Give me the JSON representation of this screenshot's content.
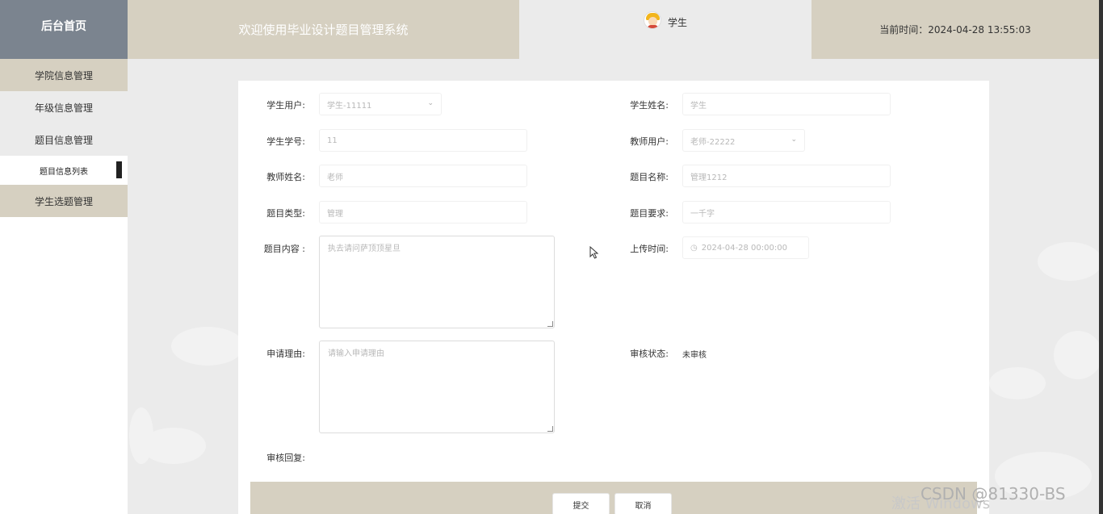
{
  "header": {
    "brand": "后台首页",
    "welcome": "欢迎使用毕业设计题目管理系统",
    "user_name": "学生",
    "current_time": "当前时间：2024-04-28 13:55:03"
  },
  "sidebar": {
    "items": [
      {
        "label": "学院信息管理"
      },
      {
        "label": "年级信息管理"
      },
      {
        "label": "题目信息管理"
      },
      {
        "label": "题目信息列表"
      },
      {
        "label": "学生选题管理"
      }
    ]
  },
  "form": {
    "student_user": {
      "label": "学生用户:",
      "value": "学生-11111"
    },
    "student_name": {
      "label": "学生姓名:",
      "value": "学生"
    },
    "student_no": {
      "label": "学生学号:",
      "value": "11"
    },
    "teacher_user": {
      "label": "教师用户:",
      "value": "老师-22222"
    },
    "teacher_name": {
      "label": "教师姓名:",
      "value": "老师"
    },
    "topic_name": {
      "label": "题目名称:",
      "value": "管理1212"
    },
    "topic_type": {
      "label": "题目类型:",
      "value": "管理"
    },
    "topic_requirement": {
      "label": "题目要求:",
      "value": "一千字"
    },
    "topic_content": {
      "label": "题目内容 :",
      "value": "执去请问萨顶顶星旦"
    },
    "upload_time": {
      "label": "上传时间:",
      "value": "2024-04-28 00:00:00"
    },
    "apply_reason": {
      "label": "申请理由:",
      "placeholder": "请输入申请理由"
    },
    "review_status": {
      "label": "审核状态:",
      "value": "未审核"
    },
    "review_reply": {
      "label": "审核回复:"
    }
  },
  "buttons": {
    "submit": "提交",
    "cancel": "取消"
  },
  "watermarks": {
    "windows": "激活 Windows",
    "csdn": "CSDN @81330-BS"
  }
}
